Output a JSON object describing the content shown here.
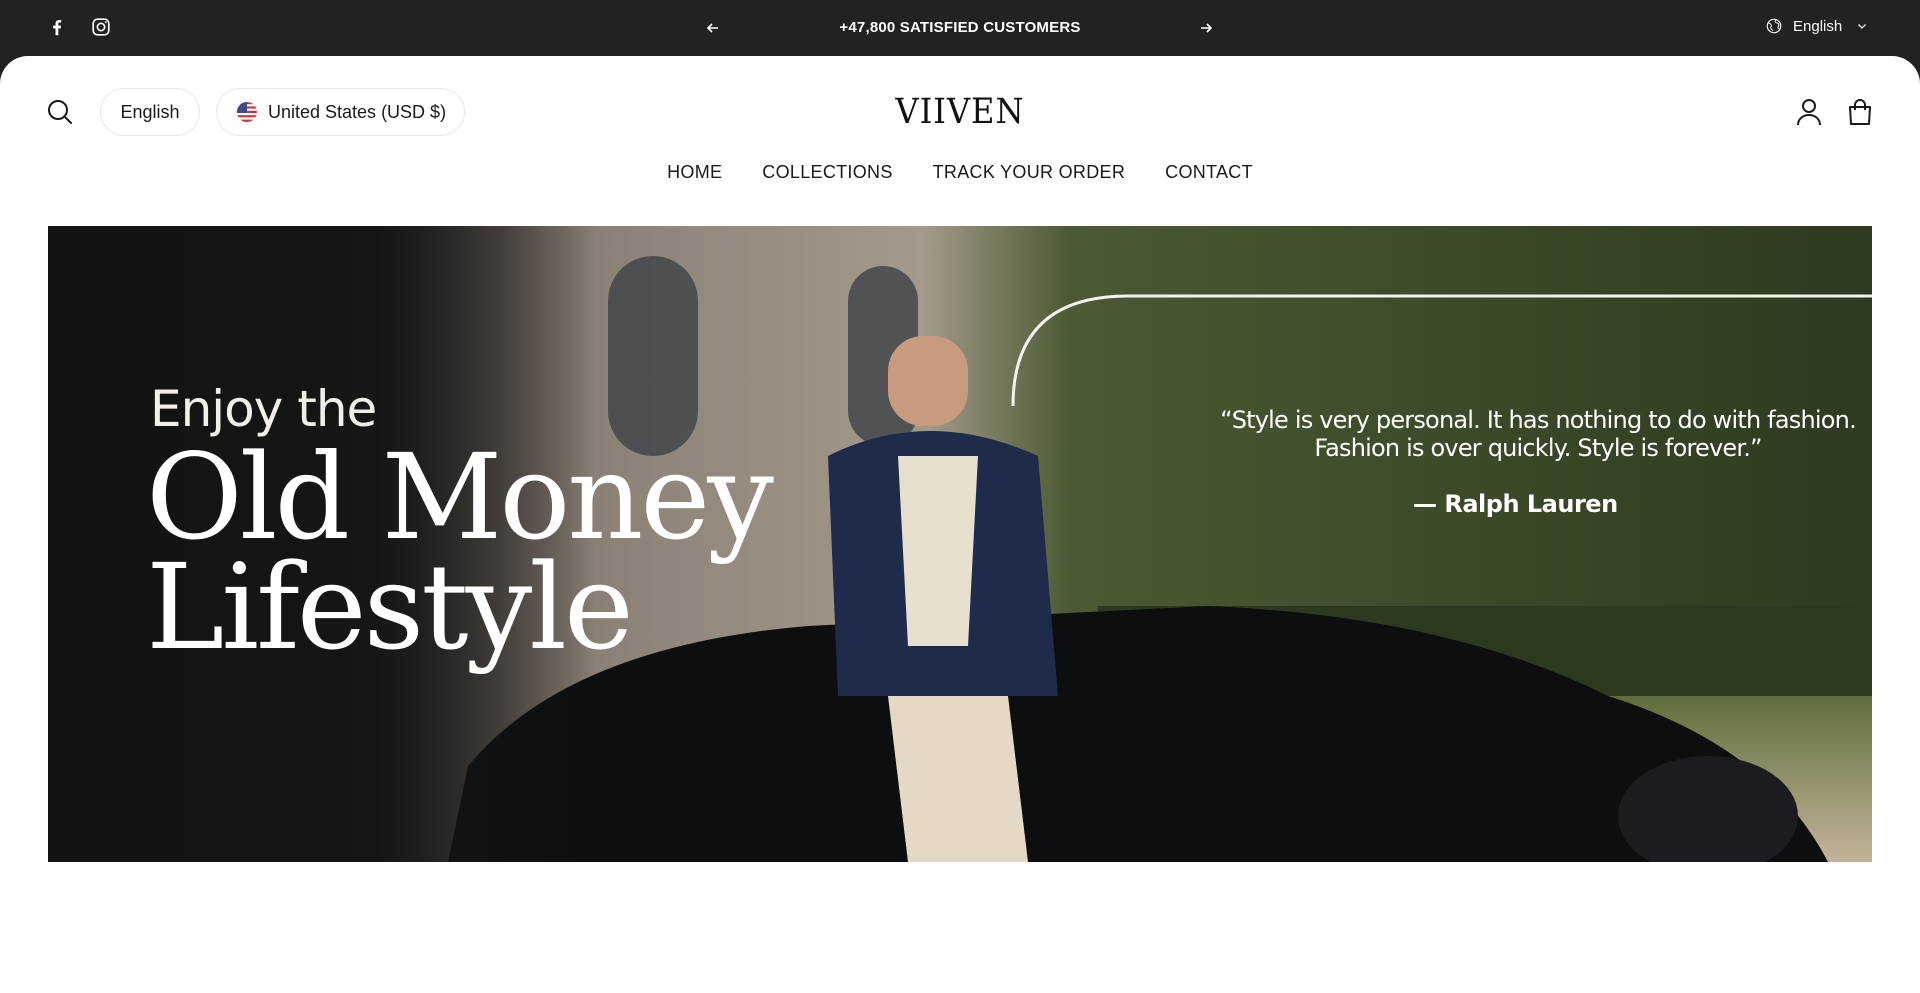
{
  "announcement": {
    "text": "+47,800 SATISFIED CUSTOMERS",
    "language": "English",
    "social_icons": [
      "facebook-icon",
      "instagram-icon"
    ]
  },
  "header": {
    "logo": "VIIVEN",
    "language_pill": "English",
    "country_pill": "United States (USD $)",
    "icons": [
      "search-icon",
      "account-icon",
      "cart-icon"
    ]
  },
  "nav": {
    "items": [
      "HOME",
      "COLLECTIONS",
      "TRACK YOUR ORDER",
      "CONTACT"
    ]
  },
  "hero": {
    "headline_small": "Enjoy the",
    "headline_line1": "Old Money",
    "headline_line2": "Lifestyle",
    "quote_line1": "“Style is very personal. It has nothing to do with fashion.",
    "quote_line2": "Fashion is over quickly. Style is forever.”",
    "quote_author": "— Ralph Lauren"
  },
  "colors": {
    "topbar_bg": "#222222",
    "page_bg": "#ffffff",
    "text": "#1a1a1a"
  }
}
